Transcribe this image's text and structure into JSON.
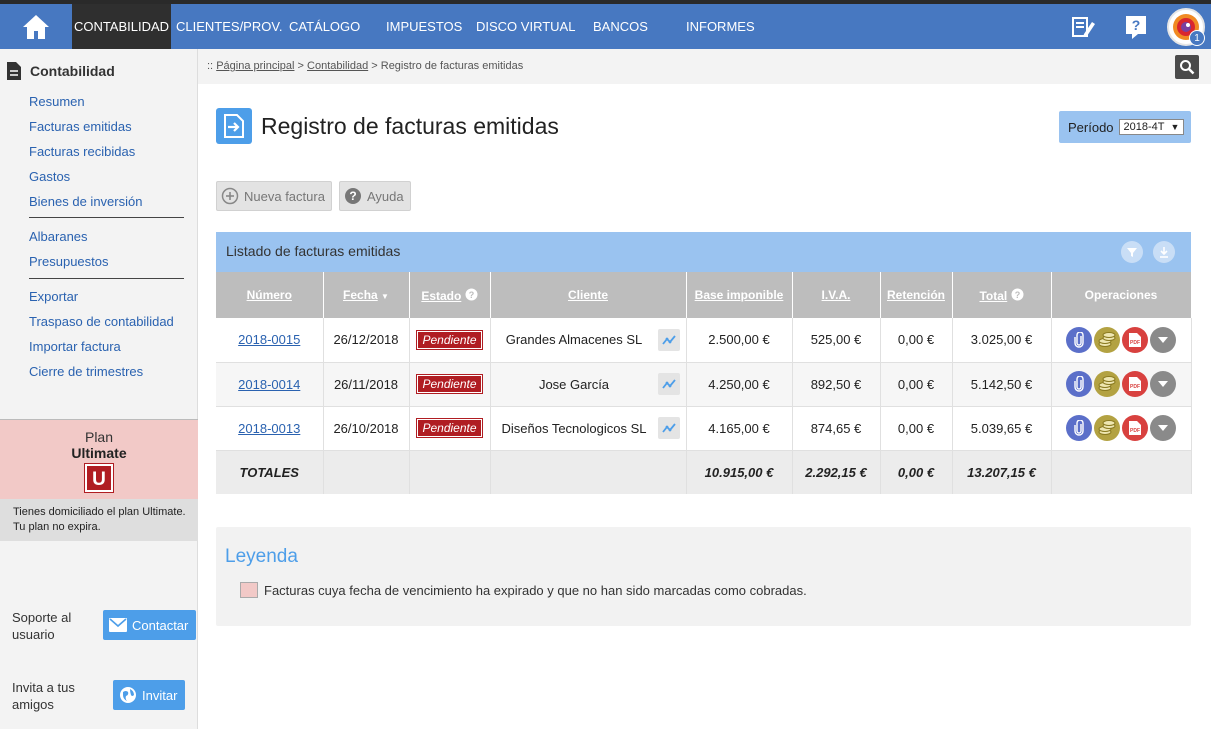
{
  "nav": {
    "items": [
      "CONTABILIDAD",
      "CLIENTES/PROV.",
      "CATÁLOGO",
      "IMPUESTOS",
      "DISCO VIRTUAL",
      "BANCOS",
      "INFORMES"
    ],
    "active": "CONTABILIDAD",
    "avatar_badge": "1"
  },
  "sidebar": {
    "title": "Contabilidad",
    "group1": [
      "Resumen",
      "Facturas emitidas",
      "Facturas recibidas",
      "Gastos",
      "Bienes de inversión"
    ],
    "group2": [
      "Albaranes",
      "Presupuestos"
    ],
    "group3": [
      "Exportar",
      "Traspaso de contabilidad",
      "Importar factura",
      "Cierre de trimestres"
    ],
    "plan": {
      "line1": "Plan",
      "line2": "Ultimate",
      "letter": "U",
      "color": "#b01d22"
    },
    "plan_note": [
      "Tienes domiciliado el plan Ultimate.",
      "Tu plan no expira."
    ],
    "support": {
      "label_lines": [
        "Soporte al",
        "usuario"
      ],
      "button": "Contactar"
    },
    "invite": {
      "label_lines": [
        "Invita a tus",
        "amigos"
      ],
      "button": "Invitar"
    }
  },
  "breadcrumb": {
    "prefix": "::",
    "items": [
      "Página principal",
      "Contabilidad"
    ],
    "current": "Registro de facturas emitidas"
  },
  "page": {
    "title": "Registro de facturas emitidas",
    "periodo_label": "Período",
    "periodo_value": "2018-4T",
    "new_invoice_button": "Nueva factura",
    "help_button": "Ayuda"
  },
  "list": {
    "title": "Listado de facturas emitidas",
    "columns": [
      "Número",
      "Fecha",
      "Estado",
      "Cliente",
      "Base imponible",
      "I.V.A.",
      "Retención",
      "Total",
      "Operaciones"
    ],
    "rows": [
      {
        "numero": "2018-0015",
        "fecha": "26/12/2018",
        "estado": "Pendiente",
        "cliente": "Grandes Almacenes SL",
        "base": "2.500,00 €",
        "iva": "525,00 €",
        "retencion": "0,00 €",
        "total": "3.025,00 €"
      },
      {
        "numero": "2018-0014",
        "fecha": "26/11/2018",
        "estado": "Pendiente",
        "cliente": "Jose García",
        "base": "4.250,00 €",
        "iva": "892,50 €",
        "retencion": "0,00 €",
        "total": "5.142,50 €"
      },
      {
        "numero": "2018-0013",
        "fecha": "26/10/2018",
        "estado": "Pendiente",
        "cliente": "Diseños Tecnologicos SL",
        "base": "4.165,00 €",
        "iva": "874,65 €",
        "retencion": "0,00 €",
        "total": "5.039,65 €"
      }
    ],
    "totals": {
      "label": "TOTALES",
      "base": "10.915,00 €",
      "iva": "2.292,15 €",
      "retencion": "0,00 €",
      "total": "13.207,15 €"
    }
  },
  "legend": {
    "title": "Leyenda",
    "text": "Facturas cuya fecha de vencimiento ha expirado y que no han sido marcadas como cobradas.",
    "swatch_color": "#f2c9c7"
  },
  "colors": {
    "nav": "#4778c1",
    "accent": "#4d9ee9",
    "danger": "#b01d22"
  }
}
